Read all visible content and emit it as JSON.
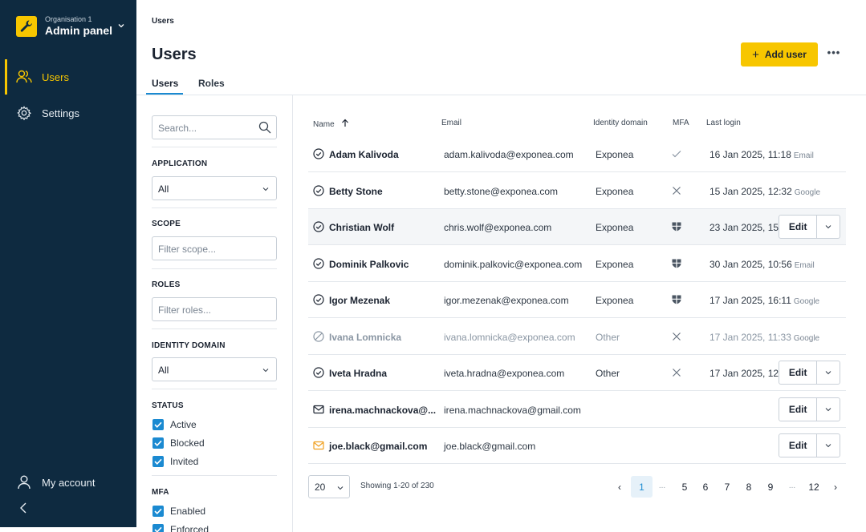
{
  "sidebar": {
    "org_small": "Organisation 1",
    "org_name": "Admin panel",
    "nav": [
      {
        "label": "Users",
        "icon": "users-icon",
        "active": true
      },
      {
        "label": "Settings",
        "icon": "gear-icon",
        "active": false
      }
    ],
    "account_label": "My account",
    "accent": "#f7c600",
    "bg": "#0e2a40"
  },
  "header": {
    "breadcrumb": "Users",
    "title": "Users",
    "tabs": [
      "Users",
      "Roles"
    ],
    "add_user": "Add user",
    "more": "•••"
  },
  "filters": {
    "search_placeholder": "Search...",
    "application_label": "APPLICATION",
    "application_value": "All",
    "scope_label": "SCOPE",
    "scope_placeholder": "Filter scope...",
    "roles_label": "ROLES",
    "roles_placeholder": "Filter roles...",
    "identity_label": "IDENTITY DOMAIN",
    "identity_value": "All",
    "status_label": "STATUS",
    "status_options": [
      "Active",
      "Blocked",
      "Invited"
    ],
    "mfa_label": "MFA",
    "mfa_options": [
      "Enabled",
      "Enforced"
    ]
  },
  "table": {
    "columns": [
      "Name",
      "Email",
      "Identity domain",
      "MFA",
      "Last login"
    ],
    "sort_icon": "arrow-up-icon",
    "rows": [
      {
        "name": "Adam Kalivoda",
        "email": "adam.kalivoda@exponea.com",
        "domain": "Exponea",
        "mfa": "check",
        "last_login": "16 Jan 2025, 11:18",
        "via": "Email",
        "status": "active"
      },
      {
        "name": "Betty Stone",
        "email": "betty.stone@exponea.com",
        "domain": "Exponea",
        "mfa": "x",
        "last_login": "15 Jan 2025, 12:32",
        "via": "Google",
        "status": "active"
      },
      {
        "name": "Christian Wolf",
        "email": "chris.wolf@exponea.com",
        "domain": "Exponea",
        "mfa": "shield",
        "last_login": "23 Jan 2025, 15",
        "via": "",
        "status": "active",
        "edit": true,
        "highlight": true
      },
      {
        "name": "Dominik Palkovic",
        "email": "dominik.palkovic@exponea.com",
        "domain": "Exponea",
        "mfa": "shield",
        "last_login": "30 Jan 2025, 10:56",
        "via": "Email",
        "status": "active"
      },
      {
        "name": "Igor Mezenak",
        "email": "igor.mezenak@exponea.com",
        "domain": "Exponea",
        "mfa": "shield",
        "last_login": "17 Jan 2025, 16:11",
        "via": "Google",
        "status": "active"
      },
      {
        "name": "Ivana Lomnicka",
        "email": "ivana.lomnicka@exponea.com",
        "domain": "Other",
        "mfa": "x",
        "last_login": "17 Jan 2025, 11:33",
        "via": "Google",
        "status": "blocked"
      },
      {
        "name": "Iveta Hradna",
        "email": "iveta.hradna@exponea.com",
        "domain": "Other",
        "mfa": "x",
        "last_login": "17 Jan 2025, 12:",
        "via": "",
        "status": "active",
        "edit": true
      },
      {
        "name": "irena.machnackova@...",
        "email": "irena.machnackova@gmail.com",
        "domain": "",
        "mfa": "",
        "last_login": "",
        "via": "",
        "status": "invited",
        "edit": true
      },
      {
        "name": "joe.black@gmail.com",
        "email": "joe.black@gmail.com",
        "domain": "",
        "mfa": "",
        "last_login": "",
        "via": "",
        "status": "invited-orange",
        "edit": true
      }
    ],
    "edit_label": "Edit"
  },
  "footer": {
    "per_page": "20",
    "showing": "Showing 1-20 of 230",
    "pages": [
      "‹",
      "1",
      "...",
      "5",
      "6",
      "7",
      "8",
      "9",
      "...",
      "12",
      "›"
    ],
    "current_page": "1"
  },
  "colors": {
    "primary": "#1b8ad1",
    "accent": "#f7c600",
    "invite_orange": "#f0a020"
  }
}
